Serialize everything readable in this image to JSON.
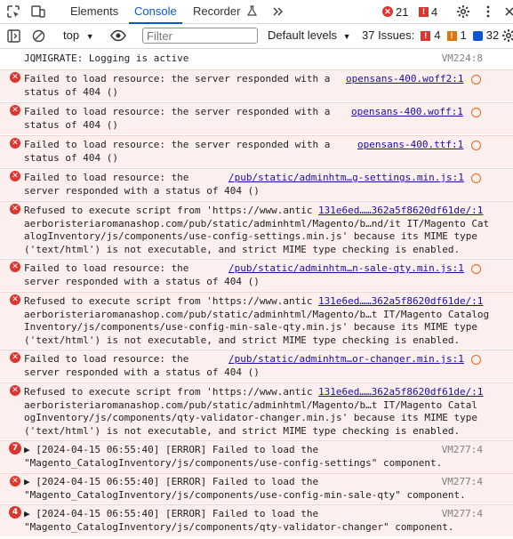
{
  "tabs": {
    "elements": "Elements",
    "console": "Console",
    "recorder": "Recorder",
    "errors_count": "21",
    "warnings_count": "4"
  },
  "toolbar": {
    "context": "top",
    "filter_placeholder": "Filter",
    "levels": "Default levels",
    "issues_label": "37 Issues:",
    "issues_errors": "4",
    "issues_warnings": "1",
    "issues_info": "32"
  },
  "console": {
    "info": {
      "text": "JQMIGRATE: Logging is active",
      "source": "VM224:8"
    },
    "messages": [
      {
        "l1": "Failed to load resource: the server responded with a",
        "l2": "status of 404 ()",
        "src": "opensans-400.woff2:1"
      },
      {
        "l1": "Failed to load resource: the server responded with a",
        "l2": "status of 404 ()",
        "src": "opensans-400.woff:1"
      },
      {
        "l1": "Failed to load resource: the server responded with a",
        "l2": "status of 404 ()",
        "src": "opensans-400.ttf:1"
      },
      {
        "l1": "Failed to load resource: the",
        "l2": "server responded with a status of 404 ()",
        "src": "/pub/static/adminhtm…g-settings.min.js:1"
      },
      {
        "l1a": "Refused to execute script from '",
        "l1b": "https://www.antic",
        "l1c": "131e6ed……362a5f8620df61de/:1",
        "l2": "aerboristeriaromanashop.com/pub/static/adminhtml/Magento/b…nd/it IT/Magento Cat",
        "l3a": "alogInventory/js/components/use-config-settings.min.js",
        "l3b": "' because its MIME type",
        "l4": "('text/html') is not executable, and strict MIME type checking is enabled."
      },
      {
        "l1": "Failed to load resource: the",
        "l2": "server responded with a status of 404 ()",
        "src": "/pub/static/adminhtm…n-sale-qty.min.js:1"
      },
      {
        "l1a": "Refused to execute script from '",
        "l1b": "https://www.antic",
        "l1c": "131e6ed……362a5f8620df61de/:1",
        "l2": "aerboristeriaromanashop.com/pub/static/adminhtml/Magento/b…t IT/Magento Catalog",
        "l3a": "Inventory/js/components/use-config-min-sale-qty.min.js",
        "l3b": "' because its MIME type",
        "l4": "('text/html') is not executable, and strict MIME type checking is enabled."
      },
      {
        "l1": "Failed to load resource: the",
        "l2": "server responded with a status of 404 ()",
        "src": "/pub/static/adminhtm…or-changer.min.js:1"
      },
      {
        "l1a": "Refused to execute script from '",
        "l1b": "https://www.antic",
        "l1c": "131e6ed……362a5f8620df61de/:1",
        "l2": "aerboristeriaromanashop.com/pub/static/adminhtml/Magento/b…t IT/Magento Catal",
        "l3a": "ogInventory/js/components/qty-validator-changer.min.js",
        "l3b": "' because its MIME type",
        "l4": "('text/html') is not executable, and strict MIME type checking is enabled."
      }
    ],
    "grouped": [
      {
        "count": "7",
        "l1": "▶ [2024-04-15 06:55:40] [ERROR] Failed to load the",
        "l2": "\"Magento_CatalogInventory/js/components/use-config-settings\" component.",
        "src": "VM277:4"
      },
      {
        "count": "",
        "l1": "▶ [2024-04-15 06:55:40] [ERROR] Failed to load the",
        "l2": "\"Magento_CatalogInventory/js/components/use-config-min-sale-qty\" component.",
        "src": "VM277:4"
      },
      {
        "count": "4",
        "l1": "▶ [2024-04-15 06:55:40] [ERROR] Failed to load the",
        "l2": "\"Magento_CatalogInventory/js/components/qty-validator-changer\" component.",
        "src": "VM277:4"
      }
    ]
  },
  "colors": {
    "accent": "#0b57d0",
    "error": "#dc362e",
    "error_bg": "#fcefee",
    "warning": "#e2730b",
    "link": "#1a0dab"
  }
}
